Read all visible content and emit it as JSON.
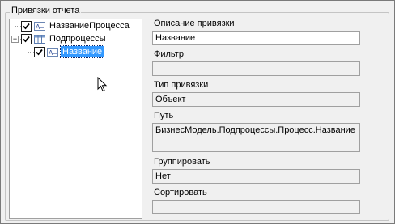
{
  "group": {
    "title": "Привязки отчета"
  },
  "tree": {
    "nodes": [
      {
        "label": "НазваниеПроцесса",
        "checked": true,
        "icon": "text-field-icon"
      },
      {
        "label": "Подпроцессы",
        "checked": true,
        "icon": "table-icon"
      },
      {
        "label": "Название",
        "checked": true,
        "icon": "text-field-icon",
        "selected": true
      }
    ]
  },
  "fields": {
    "description": {
      "label": "Описание привязки",
      "value": "Название"
    },
    "filter": {
      "label": "Фильтр",
      "value": ""
    },
    "binding_type": {
      "label": "Тип привязки",
      "value": "Объект"
    },
    "path": {
      "label": "Путь",
      "value": "БизнесМодель.Подпроцессы.Процесс.Название"
    },
    "group_by": {
      "label": "Группировать",
      "value": "Нет"
    },
    "sort": {
      "label": "Сортировать",
      "value": ""
    }
  },
  "colors": {
    "selection": "#3399ff",
    "window_bg": "#f0f0f0"
  }
}
